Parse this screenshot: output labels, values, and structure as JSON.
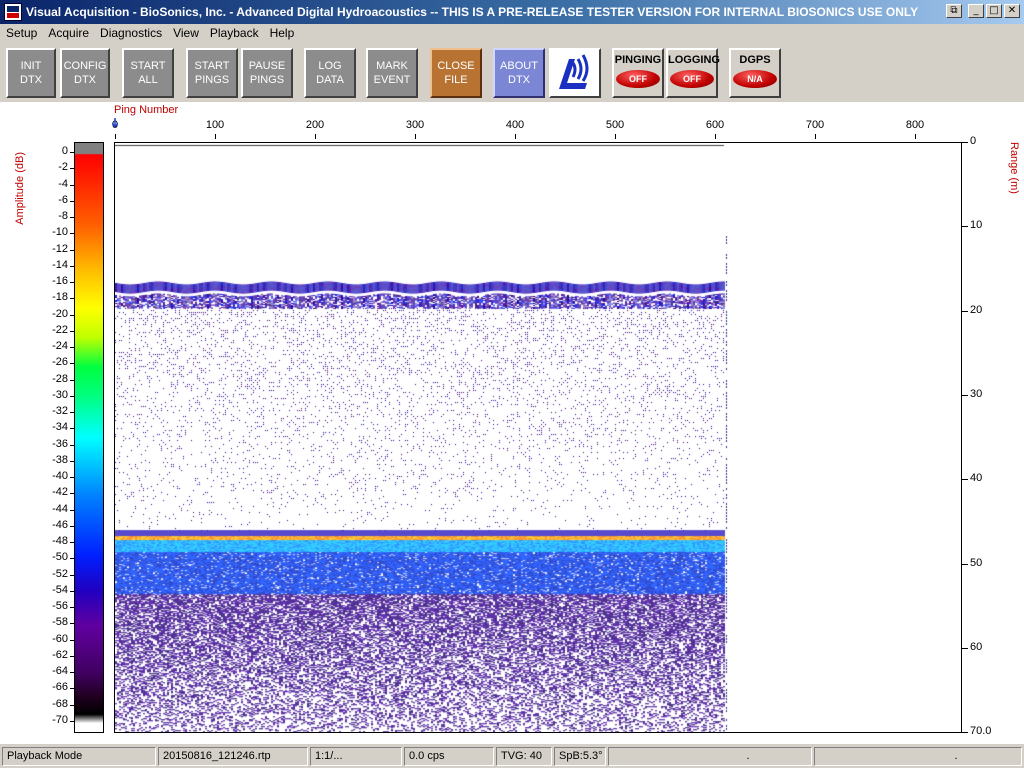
{
  "window": {
    "title": "Visual Acquisition  -  BioSonics, Inc.  -  Advanced Digital Hydroacoustics  -- THIS IS A PRE-RELEASE TESTER VERSION FOR INTERNAL BIOSONICS USE ONLY",
    "controls": [
      "restore-icon",
      "minimize-icon",
      "maximize-icon",
      "close-icon"
    ]
  },
  "menu": {
    "items": [
      {
        "label": "Setup",
        "key": "S"
      },
      {
        "label": "Acquire",
        "key": "A"
      },
      {
        "label": "Diagnostics",
        "key": "D"
      },
      {
        "label": "View",
        "key": "V"
      },
      {
        "label": "Playback",
        "key": "P"
      },
      {
        "label": "Help",
        "key": "H"
      }
    ]
  },
  "toolbar": {
    "init": {
      "l1": "INIT",
      "l2": "DTX"
    },
    "config": {
      "l1": "CONFIG",
      "l2": "DTX"
    },
    "start_all": {
      "l1": "START",
      "l2": "ALL"
    },
    "start_pings": {
      "l1": "START",
      "l2": "PINGS"
    },
    "pause_pings": {
      "l1": "PAUSE",
      "l2": "PINGS"
    },
    "log_data": {
      "l1": "LOG",
      "l2": "DATA"
    },
    "mark_event": {
      "l1": "MARK",
      "l2": "EVENT"
    },
    "close_file": {
      "l1": "CLOSE",
      "l2": "FILE"
    },
    "about": {
      "l1": "ABOUT",
      "l2": "DTX"
    },
    "logo_icon": "biosonics-logo-icon",
    "pinging": {
      "label": "PINGING",
      "state": "OFF"
    },
    "logging": {
      "label": "LOGGING",
      "state": "OFF"
    },
    "dgps": {
      "label": "DGPS",
      "state": "N/A"
    }
  },
  "plot": {
    "x_axis_label": "Ping Number",
    "x_ticks": [
      "0",
      "100",
      "200",
      "300",
      "400",
      "500",
      "600",
      "700",
      "800"
    ],
    "range_label": "Range (m)",
    "range_ticks": [
      "0",
      "10",
      "20",
      "30",
      "40",
      "50",
      "60",
      "70.0"
    ],
    "amp_label": "Amplitude (dB)",
    "amp_ticks": [
      "0",
      "-2",
      "-4",
      "-6",
      "-8",
      "-10",
      "-12",
      "-14",
      "-16",
      "-18",
      "-20",
      "-22",
      "-24",
      "-26",
      "-28",
      "-30",
      "-32",
      "-34",
      "-36",
      "-38",
      "-40",
      "-42",
      "-44",
      "-46",
      "-48",
      "-50",
      "-52",
      "-54",
      "-56",
      "-58",
      "-60",
      "-62",
      "-64",
      "-66",
      "-68",
      "-70"
    ],
    "surface_band_range_m": 17,
    "bottom_range_m": 46.5,
    "last_ping": 610
  },
  "statusbar": {
    "mode": "Playback Mode",
    "file": "20150816_121246.rtp",
    "ratio": "1:1/...",
    "cps": "0.0 cps",
    "tvg": "TVG: 40",
    "spb": "SpB:5.3°",
    "cell7": ".",
    "cell8": "."
  }
}
